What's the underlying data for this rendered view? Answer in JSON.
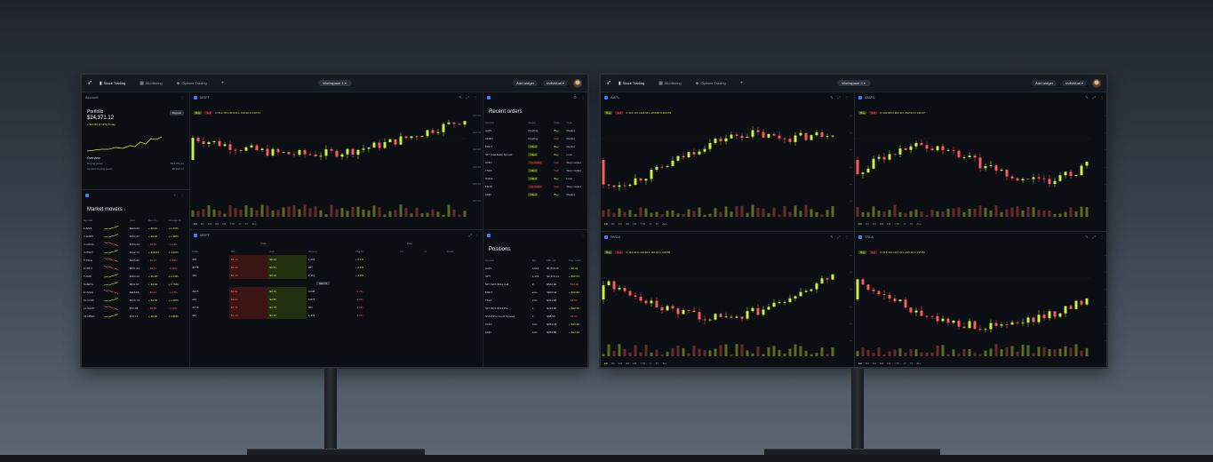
{
  "colors": {
    "up": "#c8f03c",
    "down": "#ff5a5a",
    "accent": "#3b82f6",
    "bg": "#0b0e12"
  },
  "left": {
    "tabs": [
      {
        "icon": "candles-icon",
        "label": "Stock Trading"
      },
      {
        "icon": "grid-icon",
        "label": "Monitoring"
      },
      {
        "icon": "layers-icon",
        "label": "Options Trading"
      }
    ],
    "workspace": "Workspace 1",
    "add_widget": "Add widget",
    "account": "Individual",
    "balance": {
      "header": "Account",
      "title": "Portfolio",
      "value": "$24,371.12",
      "change": "+ $23.89 (0.12%) Today",
      "deposit": "Deposit",
      "overview": "Overview",
      "rows": [
        {
          "k": "Buying power",
          "v": "$24,371.12"
        },
        {
          "k": "Options buying power",
          "v": "$8,200.12"
        }
      ]
    },
    "market_movers": {
      "title": "Market movers",
      "count": "1",
      "columns": [
        "Symbol",
        "",
        "Last",
        "Net ch...",
        "Change %"
      ],
      "rows": [
        {
          "n": "1",
          "sym": "AAPL",
          "trend": "up",
          "last": "$224.53",
          "net": "+ $4.31",
          "pct": "+ 1.43%"
        },
        {
          "n": "2",
          "sym": "AMZN",
          "trend": "up",
          "last": "$193.27",
          "net": "+ $3.20",
          "pct": "+ 1.68%"
        },
        {
          "n": "3",
          "sym": "GOOG",
          "trend": "down",
          "last": "$164.24",
          "net": "- $2.01",
          "pct": "- 1.21%"
        },
        {
          "n": "4",
          "sym": "MSFT",
          "trend": "up",
          "last": "$412.71",
          "net": "+ $16.84",
          "pct": "+ 4.22%"
        },
        {
          "n": "5",
          "sym": "TSLA",
          "trend": "down",
          "last": "$215.82",
          "net": "- $1.27",
          "pct": "- 0.59%"
        },
        {
          "n": "6",
          "sym": "NFLX",
          "trend": "down",
          "last": "$621.03",
          "net": "- $3.11",
          "pct": "- 0.50%"
        },
        {
          "n": "7",
          "sym": "AMD",
          "trend": "up",
          "last": "$164.22",
          "net": "+ $3.28",
          "pct": "+ 2.04%"
        },
        {
          "n": "8",
          "sym": "META",
          "trend": "up",
          "last": "$511.67",
          "net": "+ $4.02",
          "pct": "+ 0.79%"
        },
        {
          "n": "9",
          "sym": "NVDA",
          "trend": "down",
          "last": "$118.65",
          "net": "- $2.14",
          "pct": "- 1.77%"
        },
        {
          "n": "10",
          "sym": "COIN",
          "trend": "up",
          "last": "$219.73",
          "net": "+ $4.50",
          "pct": "+ 2.09%"
        },
        {
          "n": "11",
          "sym": "SHOP",
          "trend": "down",
          "last": "$72.18",
          "net": "- $0.95",
          "pct": "- 1.30%"
        },
        {
          "n": "12",
          "sym": "UBER",
          "trend": "up",
          "last": "$70.74",
          "net": "+ $0.60",
          "pct": "+ 0.86%"
        }
      ]
    },
    "main_chart": {
      "symbol": "MSFT",
      "ohlc": "O 412.15  H 413.01  L 410.92  C 412.71",
      "timeframes": [
        "1D",
        "5D",
        "1M",
        "3M",
        "6M",
        "YTD",
        "1Y",
        "5Y",
        "ALL"
      ],
      "y_ticks": [
        "416.00",
        "414.00",
        "412.00",
        "410.00",
        "408.00",
        "406.00"
      ],
      "x_ticks": [
        "11",
        "12",
        "13",
        "14",
        "15",
        "16",
        "17",
        "18"
      ]
    },
    "chain": {
      "symbol": "MSFT",
      "calls": "Calls",
      "puts": "Puts",
      "columns": [
        "Strike",
        "Bid",
        "Ask",
        "Volume",
        "Chg %",
        "OI",
        "IV",
        "Delta"
      ],
      "rows": [
        {
          "strike": "405",
          "bid": "$8.12",
          "ask": "$8.24",
          "vol": "1,204",
          "chg": "+ 3.1%"
        },
        {
          "strike": "407.5",
          "bid": "$6.40",
          "ask": "$6.51",
          "vol": "987",
          "chg": "+ 2.4%"
        },
        {
          "strike": "410",
          "bid": "$4.90",
          "ask": "$5.02",
          "vol": "2,311",
          "chg": "+ 1.9%"
        },
        {
          "strike": "412.5",
          "bid": "$3.61",
          "ask": "$3.70",
          "vol": "3,045",
          "chg": "- 0.7%"
        },
        {
          "strike": "415",
          "bid": "$2.52",
          "ask": "$2.60",
          "vol": "1,876",
          "chg": "- 1.2%"
        },
        {
          "strike": "417.5",
          "bid": "$1.71",
          "ask": "$1.78",
          "vol": "902",
          "chg": "- 2.3%"
        },
        {
          "strike": "420",
          "bid": "$1.10",
          "ask": "$1.16",
          "vol": "1,433",
          "chg": "- 3.0%"
        }
      ],
      "price_marker": "412.71"
    },
    "recent_orders": {
      "title": "Recent orders",
      "columns": [
        "Symbol",
        "Status",
        "Side",
        "Type"
      ],
      "rows": [
        {
          "sym": "AAPL",
          "status": "Pending",
          "side": "Buy",
          "type": "Market"
        },
        {
          "sym": "AMZN",
          "status": "Pending",
          "side": "Sell",
          "type": "Market"
        },
        {
          "sym": "MSFT",
          "status": "Filled",
          "side": "Buy",
          "type": "Market"
        },
        {
          "sym": "SPY Call Debit Spread",
          "status": "Filled",
          "side": "Buy",
          "type": "Limit"
        },
        {
          "sym": "COIN",
          "status": "Canceled",
          "side": "Sell",
          "type": "Stop market"
        },
        {
          "sym": "TSLA",
          "status": "Filled",
          "side": "Sell",
          "type": "Stop market"
        },
        {
          "sym": "NVDA",
          "status": "Filled",
          "side": "Buy",
          "type": "Limit"
        },
        {
          "sym": "META",
          "status": "Canceled",
          "side": "Sell",
          "type": "Stop market"
        },
        {
          "sym": "AMD",
          "status": "Filled",
          "side": "Buy",
          "type": "Market"
        }
      ]
    },
    "positions": {
      "title": "Positions",
      "columns": [
        "Symbol",
        "Qty",
        "Mkt val",
        "Day return"
      ],
      "rows": [
        {
          "sym": "AAPL",
          "qty": "4,011",
          "val": "$1,800.25",
          "ret": "+ $4.31"
        },
        {
          "sym": "SPY",
          "qty": "1,123",
          "val": "$2,400.14",
          "ret": "+ $12.04"
        },
        {
          "sym": "SPY 6/21 $510 Call",
          "qty": "2",
          "val": "$540.00",
          "ret": "- $12.00"
        },
        {
          "sym": "MSFT",
          "qty": "2.0x",
          "val": "$825.42",
          "ret": "+ $16.84"
        },
        {
          "sym": "TSLA",
          "qty": "2.0x",
          "val": "$431.64",
          "ret": "- $2.54"
        },
        {
          "sym": "SPY 6/21 $515 Put",
          "qty": "1",
          "val": "$210.00",
          "ret": "+ $20.00"
        },
        {
          "sym": "NVDA Put Credit Spread",
          "qty": "1",
          "val": "$98.00",
          "ret": "- $5.00"
        },
        {
          "sym": "COIN",
          "qty": "3.0x",
          "val": "$659.19",
          "ret": "+ $13.50"
        },
        {
          "sym": "AMD",
          "qty": "4.0x",
          "val": "$656.88",
          "ret": "+ $13.12"
        }
      ]
    }
  },
  "right": {
    "tabs": [
      {
        "icon": "candles-icon",
        "label": "Stock Trading"
      },
      {
        "icon": "grid-icon",
        "label": "Monitoring"
      },
      {
        "icon": "layers-icon",
        "label": "Options Trading"
      }
    ],
    "workspace": "Workspace 2",
    "add_widget": "Add widget",
    "account": "Individual",
    "charts": [
      {
        "symbol": "AAPL",
        "buy": "Buy",
        "sell": "Sell",
        "ohlc": "O 224.10  H 224.91  L 223.88  C 224.53"
      },
      {
        "symbol": "AMZN",
        "buy": "Buy",
        "sell": "Sell",
        "ohlc": "O 192.90  H 193.44  L 192.61  C 193.27"
      },
      {
        "symbol": "NVDA",
        "buy": "Buy",
        "sell": "Sell",
        "ohlc": "O 119.02  H 119.40  L 118.21  C 118.65"
      },
      {
        "symbol": "TSLA",
        "buy": "Buy",
        "sell": "Sell",
        "ohlc": "O 216.40  H 217.02  L 215.10  C 215.82"
      }
    ],
    "timeframes": [
      "1D",
      "5D",
      "1M",
      "3M",
      "6M",
      "YTD",
      "1Y",
      "5Y",
      "ALL"
    ]
  }
}
